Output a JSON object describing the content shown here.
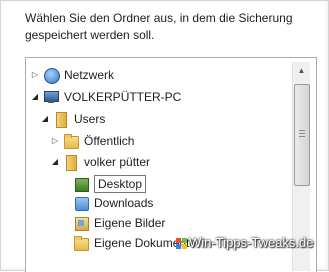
{
  "dialog": {
    "instruction": "Wählen Sie den Ordner aus, in dem die Sicherung gespeichert werden soll."
  },
  "tree": {
    "items": [
      {
        "label": "Netzwerk",
        "icon": "network-icon",
        "expander": "collapsed"
      },
      {
        "label": "VOLKERPÜTTER-PC",
        "icon": "computer-icon",
        "expander": "expanded"
      },
      {
        "label": "Users",
        "icon": "folder-icon",
        "expander": "expanded"
      },
      {
        "label": "Öffentlich",
        "icon": "folder-icon",
        "expander": "collapsed"
      },
      {
        "label": "volker pütter",
        "icon": "user-folder-icon",
        "expander": "expanded"
      },
      {
        "label": "Desktop",
        "icon": "desktop-icon",
        "expander": "none",
        "selected": true
      },
      {
        "label": "Downloads",
        "icon": "downloads-icon",
        "expander": "none"
      },
      {
        "label": "Eigene Bilder",
        "icon": "pictures-icon",
        "expander": "none"
      },
      {
        "label": "Eigene Dokumente",
        "icon": "documents-icon",
        "expander": "none"
      }
    ]
  },
  "highlight_color": "#f5f542",
  "watermark": "Win-Tipps-Tweaks.de"
}
